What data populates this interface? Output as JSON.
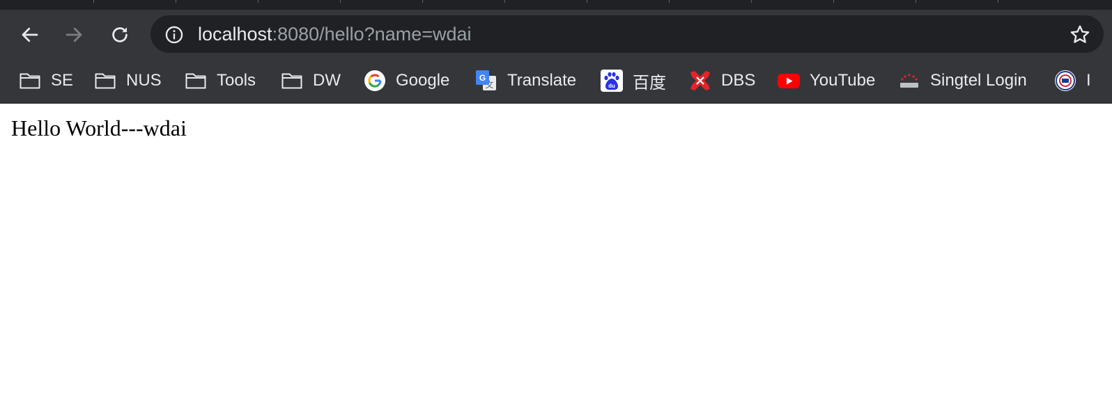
{
  "browser": {
    "url": {
      "host": "localhost",
      "rest": ":8080/hello?name=wdai"
    },
    "icons": {
      "back": "arrow-left-icon",
      "forward": "arrow-right-icon",
      "reload": "reload-icon",
      "site_info": "info-icon",
      "bookmark_star": "star-icon"
    }
  },
  "bookmarks": [
    {
      "label": "SE",
      "icon": "folder-icon"
    },
    {
      "label": "NUS",
      "icon": "folder-icon"
    },
    {
      "label": "Tools",
      "icon": "folder-icon"
    },
    {
      "label": "DW",
      "icon": "folder-icon"
    },
    {
      "label": "Google",
      "icon": "google-icon"
    },
    {
      "label": "Translate",
      "icon": "google-translate-icon"
    },
    {
      "label": "百度",
      "icon": "baidu-icon"
    },
    {
      "label": "DBS",
      "icon": "dbs-icon"
    },
    {
      "label": "YouTube",
      "icon": "youtube-icon"
    },
    {
      "label": "Singtel Login",
      "icon": "singtel-icon"
    },
    {
      "label": "I",
      "icon": "emblem-icon"
    }
  ],
  "page": {
    "text": "Hello World---wdai"
  },
  "colors": {
    "toolbar": "#35363a",
    "omnibox": "#202124",
    "text_light": "#e8eaed",
    "text_dim": "#9aa0a6"
  }
}
